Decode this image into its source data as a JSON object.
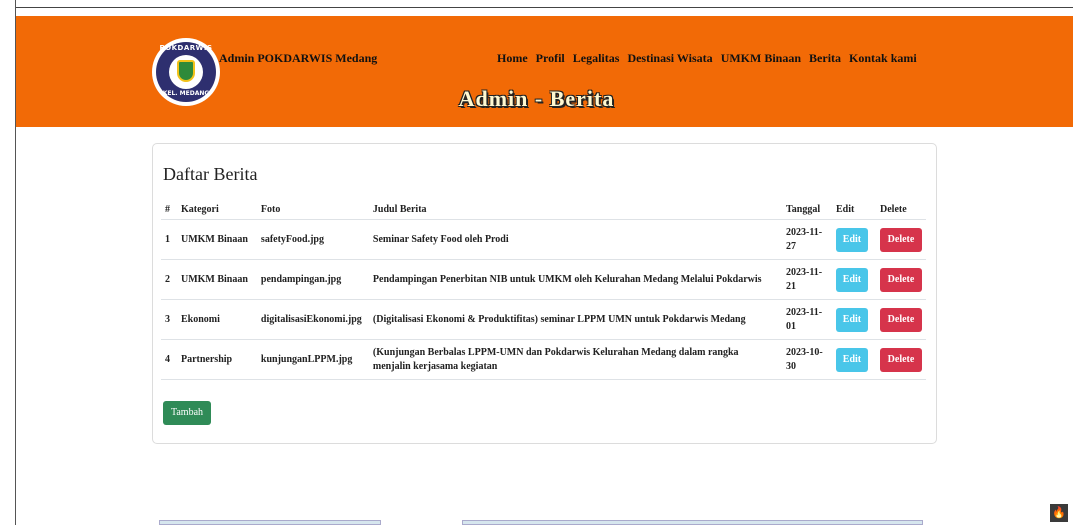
{
  "header": {
    "logo_text_top": "POKDARWIS",
    "logo_text_bottom": "KEL. MEDANG",
    "brand": "Admin POKDARWIS Medang",
    "nav": [
      "Home",
      "Profil",
      "Legalitas",
      "Destinasi Wisata",
      "UMKM Binaan",
      "Berita",
      "Kontak kami"
    ],
    "page_title": "Admin - Berita",
    "bg_color": "#f26a06"
  },
  "card": {
    "title": "Daftar Berita",
    "columns": [
      "#",
      "Kategori",
      "Foto",
      "Judul Berita",
      "Tanggal",
      "Edit",
      "Delete"
    ],
    "rows": [
      {
        "no": "1",
        "kategori": "UMKM Binaan",
        "foto": "safetyFood.jpg",
        "judul": "Seminar Safety Food oleh Prodi",
        "tanggal": "2023-11-27"
      },
      {
        "no": "2",
        "kategori": "UMKM Binaan",
        "foto": "pendampingan.jpg",
        "judul": "Pendampingan Penerbitan NIB untuk UMKM oleh Kelurahan Medang Melalui Pokdarwis",
        "tanggal": "2023-11-21"
      },
      {
        "no": "3",
        "kategori": "Ekonomi",
        "foto": "digitalisasiEkonomi.jpg",
        "judul": "(Digitalisasi Ekonomi & Produktifitas) seminar LPPM UMN untuk Pokdarwis Medang",
        "tanggal": "2023-11-01"
      },
      {
        "no": "4",
        "kategori": "Partnership",
        "foto": "kunjunganLPPM.jpg",
        "judul": "(Kunjungan Berbalas LPPM-UMN dan Pokdarwis Kelurahan Medang dalam rangka menjalin kerjasama kegiatan",
        "tanggal": "2023-10-30"
      }
    ],
    "edit_label": "Edit",
    "delete_label": "Delete",
    "add_label": "Tambah"
  },
  "colors": {
    "edit": "#49c6e9",
    "delete": "#d6344b",
    "add": "#2f8b57"
  },
  "corner_icon": "flame-icon"
}
